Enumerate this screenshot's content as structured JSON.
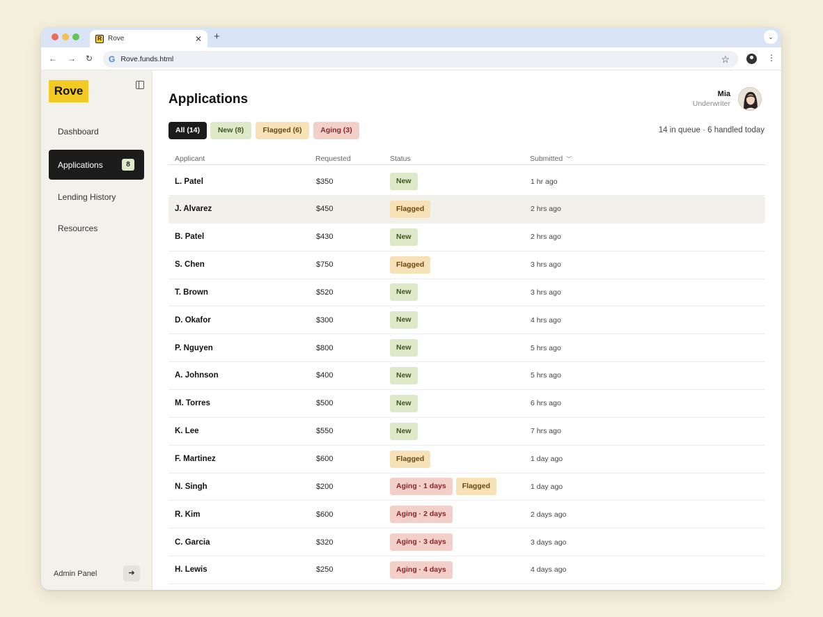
{
  "browser": {
    "tab_title": "Rove",
    "favicon_letter": "R",
    "url": "Rove.funds.html"
  },
  "sidebar": {
    "logo": "Rove",
    "items": [
      {
        "label": "Dashboard"
      },
      {
        "label": "Applications",
        "badge": "8",
        "active": true
      },
      {
        "label": "Lending History"
      },
      {
        "label": "Resources"
      }
    ],
    "admin_label": "Admin Panel"
  },
  "header": {
    "title": "Applications",
    "user_name": "Mia",
    "user_role": "Underwriter"
  },
  "filters": {
    "all": "All (14)",
    "new": "New (8)",
    "flagged": "Flagged (6)",
    "aging": "Aging (3)"
  },
  "queue_info": "14 in queue · 6 handled today",
  "table": {
    "headers": {
      "applicant": "Applicant",
      "requested": "Requested",
      "status": "Status",
      "submitted": "Submitted"
    },
    "rows": [
      {
        "name": "L. Patel",
        "amount": "$350",
        "status": [
          {
            "label": "New",
            "kind": "new"
          }
        ],
        "submitted": "1 hr ago"
      },
      {
        "name": "J. Alvarez",
        "amount": "$450",
        "status": [
          {
            "label": "Flagged",
            "kind": "flagged"
          }
        ],
        "submitted": "2 hrs ago"
      },
      {
        "name": "B. Patel",
        "amount": "$430",
        "status": [
          {
            "label": "New",
            "kind": "new"
          }
        ],
        "submitted": "2 hrs ago"
      },
      {
        "name": "S. Chen",
        "amount": "$750",
        "status": [
          {
            "label": "Flagged",
            "kind": "flagged"
          }
        ],
        "submitted": "3 hrs ago"
      },
      {
        "name": "T. Brown",
        "amount": "$520",
        "status": [
          {
            "label": "New",
            "kind": "new"
          }
        ],
        "submitted": "3 hrs ago"
      },
      {
        "name": "D. Okafor",
        "amount": "$300",
        "status": [
          {
            "label": "New",
            "kind": "new"
          }
        ],
        "submitted": "4 hrs ago"
      },
      {
        "name": "P. Nguyen",
        "amount": "$800",
        "status": [
          {
            "label": "New",
            "kind": "new"
          }
        ],
        "submitted": "5 hrs ago"
      },
      {
        "name": "A. Johnson",
        "amount": "$400",
        "status": [
          {
            "label": "New",
            "kind": "new"
          }
        ],
        "submitted": "5 hrs ago"
      },
      {
        "name": "M. Torres",
        "amount": "$500",
        "status": [
          {
            "label": "New",
            "kind": "new"
          }
        ],
        "submitted": "6 hrs ago"
      },
      {
        "name": "K. Lee",
        "amount": "$550",
        "status": [
          {
            "label": "New",
            "kind": "new"
          }
        ],
        "submitted": "7 hrs ago"
      },
      {
        "name": "F. Martinez",
        "amount": "$600",
        "status": [
          {
            "label": "Flagged",
            "kind": "flagged"
          }
        ],
        "submitted": "1 day ago"
      },
      {
        "name": "N. Singh",
        "amount": "$200",
        "status": [
          {
            "label": "Aging · 1 days",
            "kind": "aging"
          },
          {
            "label": "Flagged",
            "kind": "flagged"
          }
        ],
        "submitted": "1 day ago"
      },
      {
        "name": "R. Kim",
        "amount": "$600",
        "status": [
          {
            "label": "Aging · 2 days",
            "kind": "aging"
          }
        ],
        "submitted": "2 days ago"
      },
      {
        "name": "C. Garcia",
        "amount": "$320",
        "status": [
          {
            "label": "Aging · 3 days",
            "kind": "aging"
          }
        ],
        "submitted": "3 days ago"
      },
      {
        "name": "H. Lewis",
        "amount": "$250",
        "status": [
          {
            "label": "Aging · 4 days",
            "kind": "aging"
          }
        ],
        "submitted": "4 days ago"
      }
    ],
    "highlighted_row": 1
  },
  "colors": {
    "accent": "#f2ca23",
    "new_bg": "#dde9c8",
    "flagged_bg": "#f7e2b8",
    "aging_bg": "#f3cfca",
    "active_nav": "#1c1c1c"
  },
  "icons": {
    "back": "arrow-left-icon",
    "forward": "arrow-right-icon",
    "reload": "reload-icon",
    "bookmark": "star-icon",
    "profile": "profile-icon",
    "menu": "kebab-icon",
    "collapse": "sidebar-collapse-icon",
    "admin": "arrow-right-icon",
    "sort": "chevron-down-icon"
  }
}
